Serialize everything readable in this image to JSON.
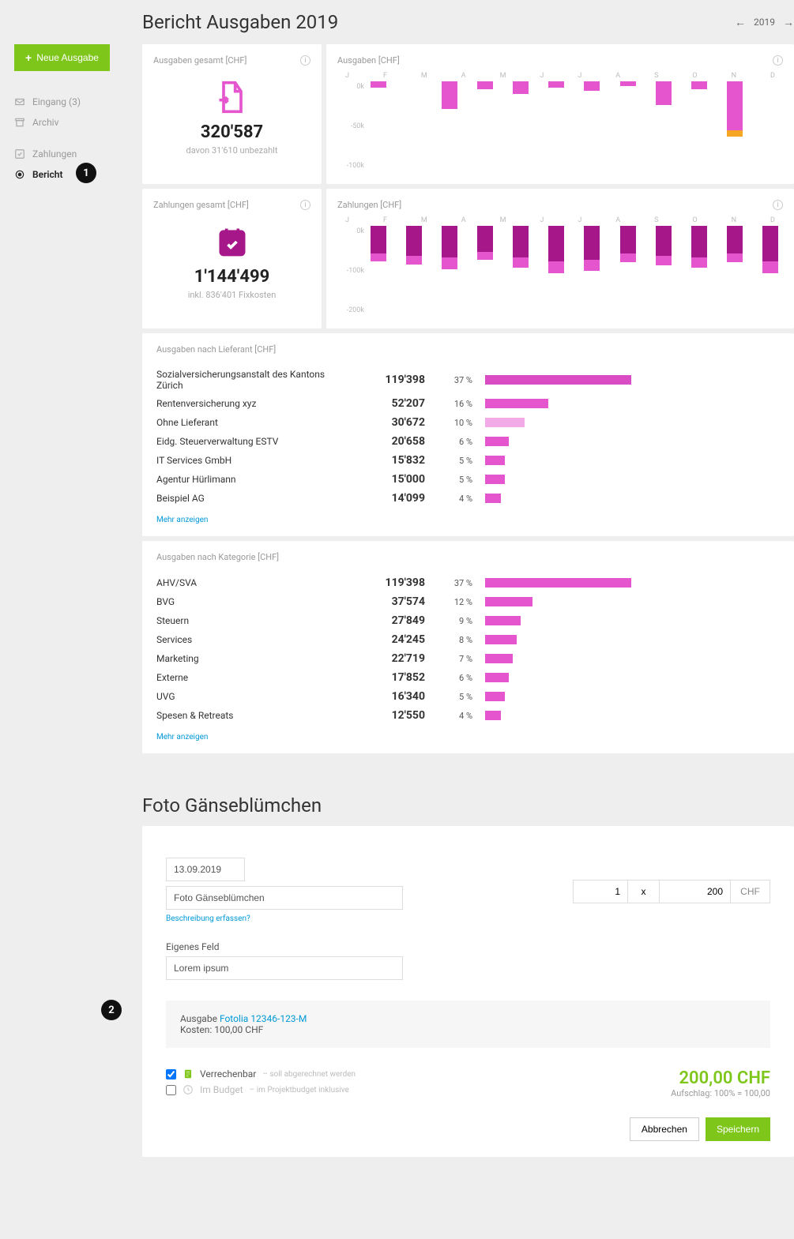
{
  "sidebar": {
    "new_btn": "Neue Ausgabe",
    "items": [
      {
        "key": "eingang",
        "label": "Eingang (3)"
      },
      {
        "key": "archiv",
        "label": "Archiv"
      },
      {
        "key": "zahlungen",
        "label": "Zahlungen"
      },
      {
        "key": "bericht",
        "label": "Bericht"
      }
    ]
  },
  "report": {
    "title": "Bericht Ausgaben 2019",
    "year": "2019",
    "cards": {
      "ausgaben_total": {
        "header": "Ausgaben gesamt [CHF]",
        "value": "320'587",
        "sub": "davon 31'610 unbezahlt"
      },
      "ausgaben_chart": {
        "header": "Ausgaben [CHF]"
      },
      "zahlungen_total": {
        "header": "Zahlungen gesamt [CHF]",
        "value": "1'144'499",
        "sub": "inkl. 836'401 Fixkosten"
      },
      "zahlungen_chart": {
        "header": "Zahlungen [CHF]"
      }
    },
    "lieferant": {
      "header": "Ausgaben nach Lieferant [CHF]",
      "rows": [
        {
          "name": "Sozialversicherungsanstalt des Kantons Zürich",
          "value": "119'398",
          "pct": "37 %",
          "bar": 37,
          "color": "#d94cc4"
        },
        {
          "name": "Rentenversicherung xyz",
          "value": "52'207",
          "pct": "16 %",
          "bar": 16,
          "color": "#e455ce"
        },
        {
          "name": "Ohne Lieferant",
          "value": "30'672",
          "pct": "10 %",
          "bar": 10,
          "color": "#f2abe6"
        },
        {
          "name": "Eidg. Steuerverwaltung ESTV",
          "value": "20'658",
          "pct": "6 %",
          "bar": 6,
          "color": "#e455ce"
        },
        {
          "name": "IT Services GmbH",
          "value": "15'832",
          "pct": "5 %",
          "bar": 5,
          "color": "#e455ce"
        },
        {
          "name": "Agentur Hürlimann",
          "value": "15'000",
          "pct": "5 %",
          "bar": 5,
          "color": "#e455ce"
        },
        {
          "name": "Beispiel AG",
          "value": "14'099",
          "pct": "4 %",
          "bar": 4,
          "color": "#e455ce"
        }
      ],
      "more": "Mehr anzeigen"
    },
    "kategorie": {
      "header": "Ausgaben nach Kategorie [CHF]",
      "rows": [
        {
          "name": "AHV/SVA",
          "value": "119'398",
          "pct": "37 %",
          "bar": 37
        },
        {
          "name": "BVG",
          "value": "37'574",
          "pct": "12 %",
          "bar": 12
        },
        {
          "name": "Steuern",
          "value": "27'849",
          "pct": "9 %",
          "bar": 9
        },
        {
          "name": "Services",
          "value": "24'245",
          "pct": "8 %",
          "bar": 8
        },
        {
          "name": "Marketing",
          "value": "22'719",
          "pct": "7 %",
          "bar": 7
        },
        {
          "name": "Externe",
          "value": "17'852",
          "pct": "6 %",
          "bar": 6
        },
        {
          "name": "UVG",
          "value": "16'340",
          "pct": "5 %",
          "bar": 5
        },
        {
          "name": "Spesen & Retreats",
          "value": "12'550",
          "pct": "4 %",
          "bar": 4
        }
      ],
      "more": "Mehr anzeigen"
    }
  },
  "form": {
    "title": "Foto Gänseblümchen",
    "date": "13.09.2019",
    "name": "Foto Gänseblümchen",
    "desc_link": "Beschreibung erfassen?",
    "qty": "1",
    "op": "x",
    "price": "200",
    "curr": "CHF",
    "custom_label": "Eigenes Feld",
    "custom_value": "Lorem ipsum",
    "link_label": "Ausgabe",
    "link_ref": "Fotolia 12346-123-M",
    "link_cost": "Kosten: 100,00 CHF",
    "opt_billable": "Verrechenbar",
    "opt_billable_hint": "– soll abgerechnet werden",
    "opt_budget": "Im Budget",
    "opt_budget_hint": "– im Projektbudget inklusive",
    "total": "200,00 CHF",
    "total_sub": "Aufschlag: 100% = 100,00",
    "cancel": "Abbrechen",
    "save": "Speichern"
  },
  "chart_data": [
    {
      "type": "bar",
      "title": "Ausgaben [CHF]",
      "categories": [
        "J",
        "F",
        "M",
        "A",
        "M",
        "J",
        "J",
        "A",
        "S",
        "O",
        "N",
        "D"
      ],
      "series": [
        {
          "name": "pink",
          "values": [
            -8,
            0,
            -35,
            -10,
            -16,
            -8,
            -12,
            -6,
            -30,
            -10,
            -62,
            0,
            0
          ],
          "color": "#e455ce"
        },
        {
          "name": "orange",
          "values": [
            0,
            0,
            0,
            0,
            0,
            0,
            0,
            0,
            0,
            0,
            -8,
            0,
            0
          ],
          "color": "#f5a623"
        }
      ],
      "y_ticks": [
        "0k",
        "-50k",
        "-100k"
      ],
      "ylim": [
        -100,
        0
      ]
    },
    {
      "type": "bar",
      "title": "Zahlungen [CHF]",
      "categories": [
        "J",
        "F",
        "M",
        "A",
        "M",
        "J",
        "J",
        "A",
        "S",
        "O",
        "N",
        "D"
      ],
      "series": [
        {
          "name": "dark",
          "values": [
            -70,
            -75,
            -80,
            -65,
            -80,
            -90,
            -85,
            -70,
            -75,
            -80,
            -70,
            -90
          ],
          "color": "#a61889"
        },
        {
          "name": "pink",
          "values": [
            -20,
            -22,
            -30,
            -20,
            -25,
            -30,
            -28,
            -22,
            -24,
            -26,
            -22,
            -30
          ],
          "color": "#e455ce"
        }
      ],
      "y_ticks": [
        "0k",
        "-100k",
        "-200k"
      ],
      "ylim": [
        -200,
        0
      ]
    }
  ],
  "badges": {
    "one": "1",
    "two": "2"
  }
}
